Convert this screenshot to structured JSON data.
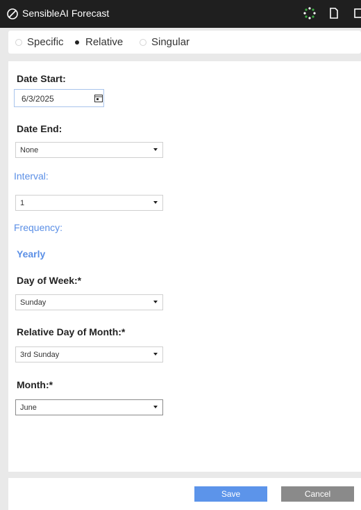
{
  "titlebar": {
    "app_title": "SensibleAI Forecast",
    "icons": [
      "forecast-logo-icon",
      "loading-spinner-icon",
      "document-icon",
      "window-icon"
    ]
  },
  "mode": {
    "options": [
      {
        "label": "Specific",
        "checked": false
      },
      {
        "label": "Relative",
        "checked": true
      },
      {
        "label": "Singular",
        "checked": false
      }
    ]
  },
  "form": {
    "date_start": {
      "label": "Date Start:",
      "value": "6/3/2025"
    },
    "date_end": {
      "label": "Date End:",
      "value": "None"
    },
    "interval": {
      "label": "Interval:",
      "value": "1"
    },
    "frequency": {
      "label": "Frequency:",
      "value": "Yearly"
    },
    "day_of_week": {
      "label": "Day of Week:*",
      "value": "Sunday"
    },
    "relative_day": {
      "label": "Relative Day of Month:*",
      "value": "3rd Sunday"
    },
    "month": {
      "label": "Month:*",
      "value": "June"
    }
  },
  "footer": {
    "save_label": "Save",
    "cancel_label": "Cancel"
  },
  "colors": {
    "accent": "#5c94ea",
    "label_blue": "#5b8fe6",
    "titlebar": "#1f1f1f",
    "cancel": "#8a8a8a"
  }
}
